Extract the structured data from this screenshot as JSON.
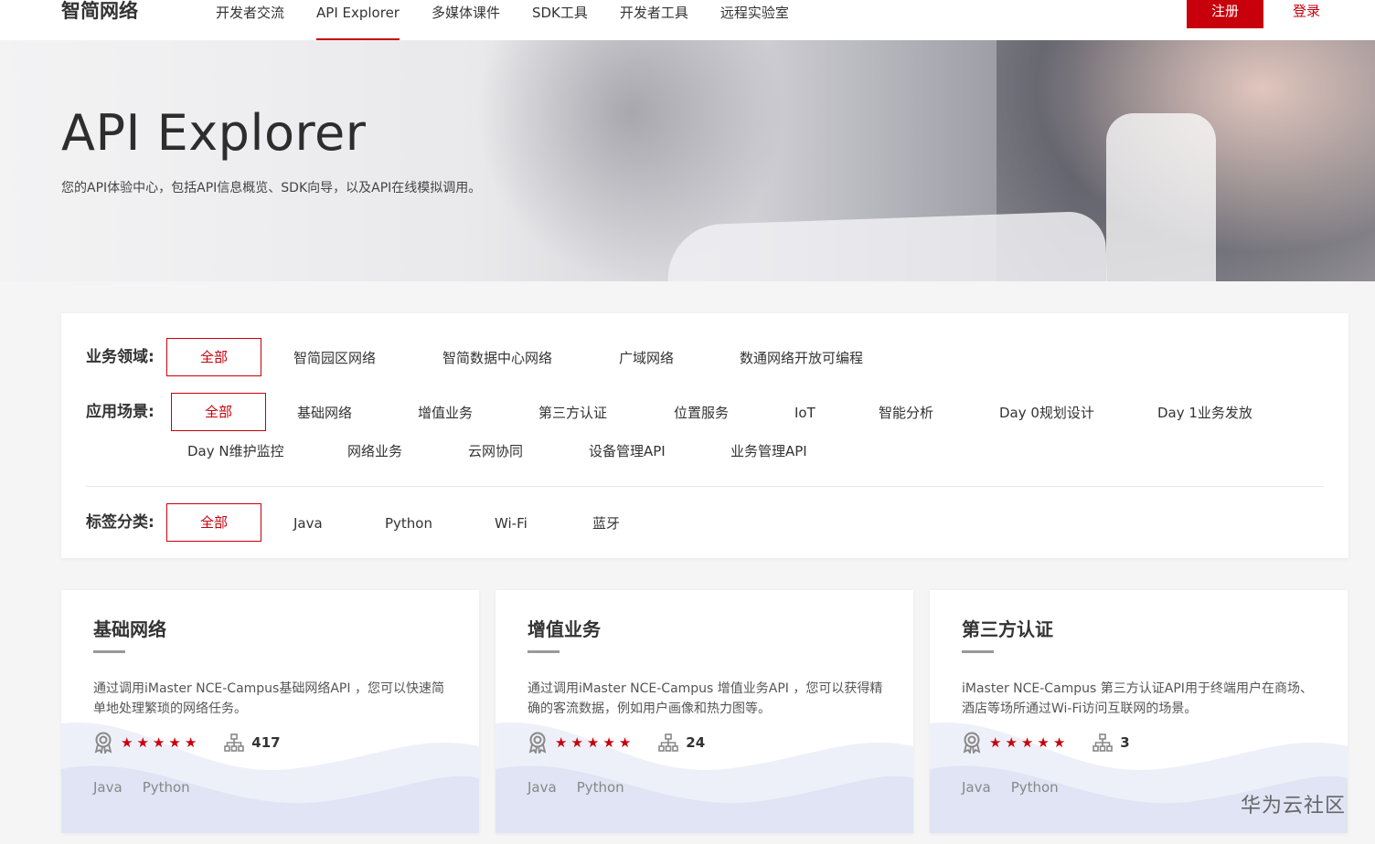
{
  "header": {
    "logo": "智简网络",
    "nav": [
      "开发者交流",
      "API Explorer",
      "多媒体课件",
      "SDK工具",
      "开发者工具",
      "远程实验室"
    ],
    "active_nav": "API Explorer",
    "register": "注册",
    "login": "登录"
  },
  "banner": {
    "title": "API Explorer",
    "subtitle": "您的API体验中心，包括API信息概览、SDK向导，以及API在线模拟调用。"
  },
  "filters": {
    "domain": {
      "label": "业务领域:",
      "options": [
        "全部",
        "智简园区网络",
        "智简数据中心网络",
        "广域网络",
        "数通网络开放可编程"
      ]
    },
    "scenario": {
      "label": "应用场景:",
      "options": [
        "全部",
        "基础网络",
        "增值业务",
        "第三方认证",
        "位置服务",
        "IoT",
        "智能分析",
        "Day 0规划设计",
        "Day 1业务发放",
        "Day N维护监控",
        "网络业务",
        "云网协同",
        "设备管理API",
        "业务管理API"
      ]
    },
    "tags": {
      "label": "标签分类:",
      "options": [
        "全部",
        "Java",
        "Python",
        "Wi-Fi",
        "蓝牙"
      ]
    }
  },
  "cards": [
    {
      "title": "基础网络",
      "desc": "通过调用iMaster NCE-Campus基础网络API ，您可以快速简单地处理繁琐的网络任务。",
      "stars": 5,
      "count": "417",
      "tags": [
        "Java",
        "Python"
      ]
    },
    {
      "title": "增值业务",
      "desc": "通过调用iMaster NCE-Campus 增值业务API ，您可以获得精确的客流数据，例如用户画像和热力图等。",
      "stars": 5,
      "count": "24",
      "tags": [
        "Java",
        "Python"
      ]
    },
    {
      "title": "第三方认证",
      "desc": "iMaster NCE-Campus 第三方认证API用于终端用户在商场、酒店等场所通过Wi-Fi访问互联网的场景。",
      "stars": 5,
      "count": "3",
      "tags": [
        "Java",
        "Python"
      ]
    }
  ],
  "watermark": "华为云社区",
  "colors": {
    "accent": "#c7000b",
    "wave": "#e3e6f5"
  }
}
